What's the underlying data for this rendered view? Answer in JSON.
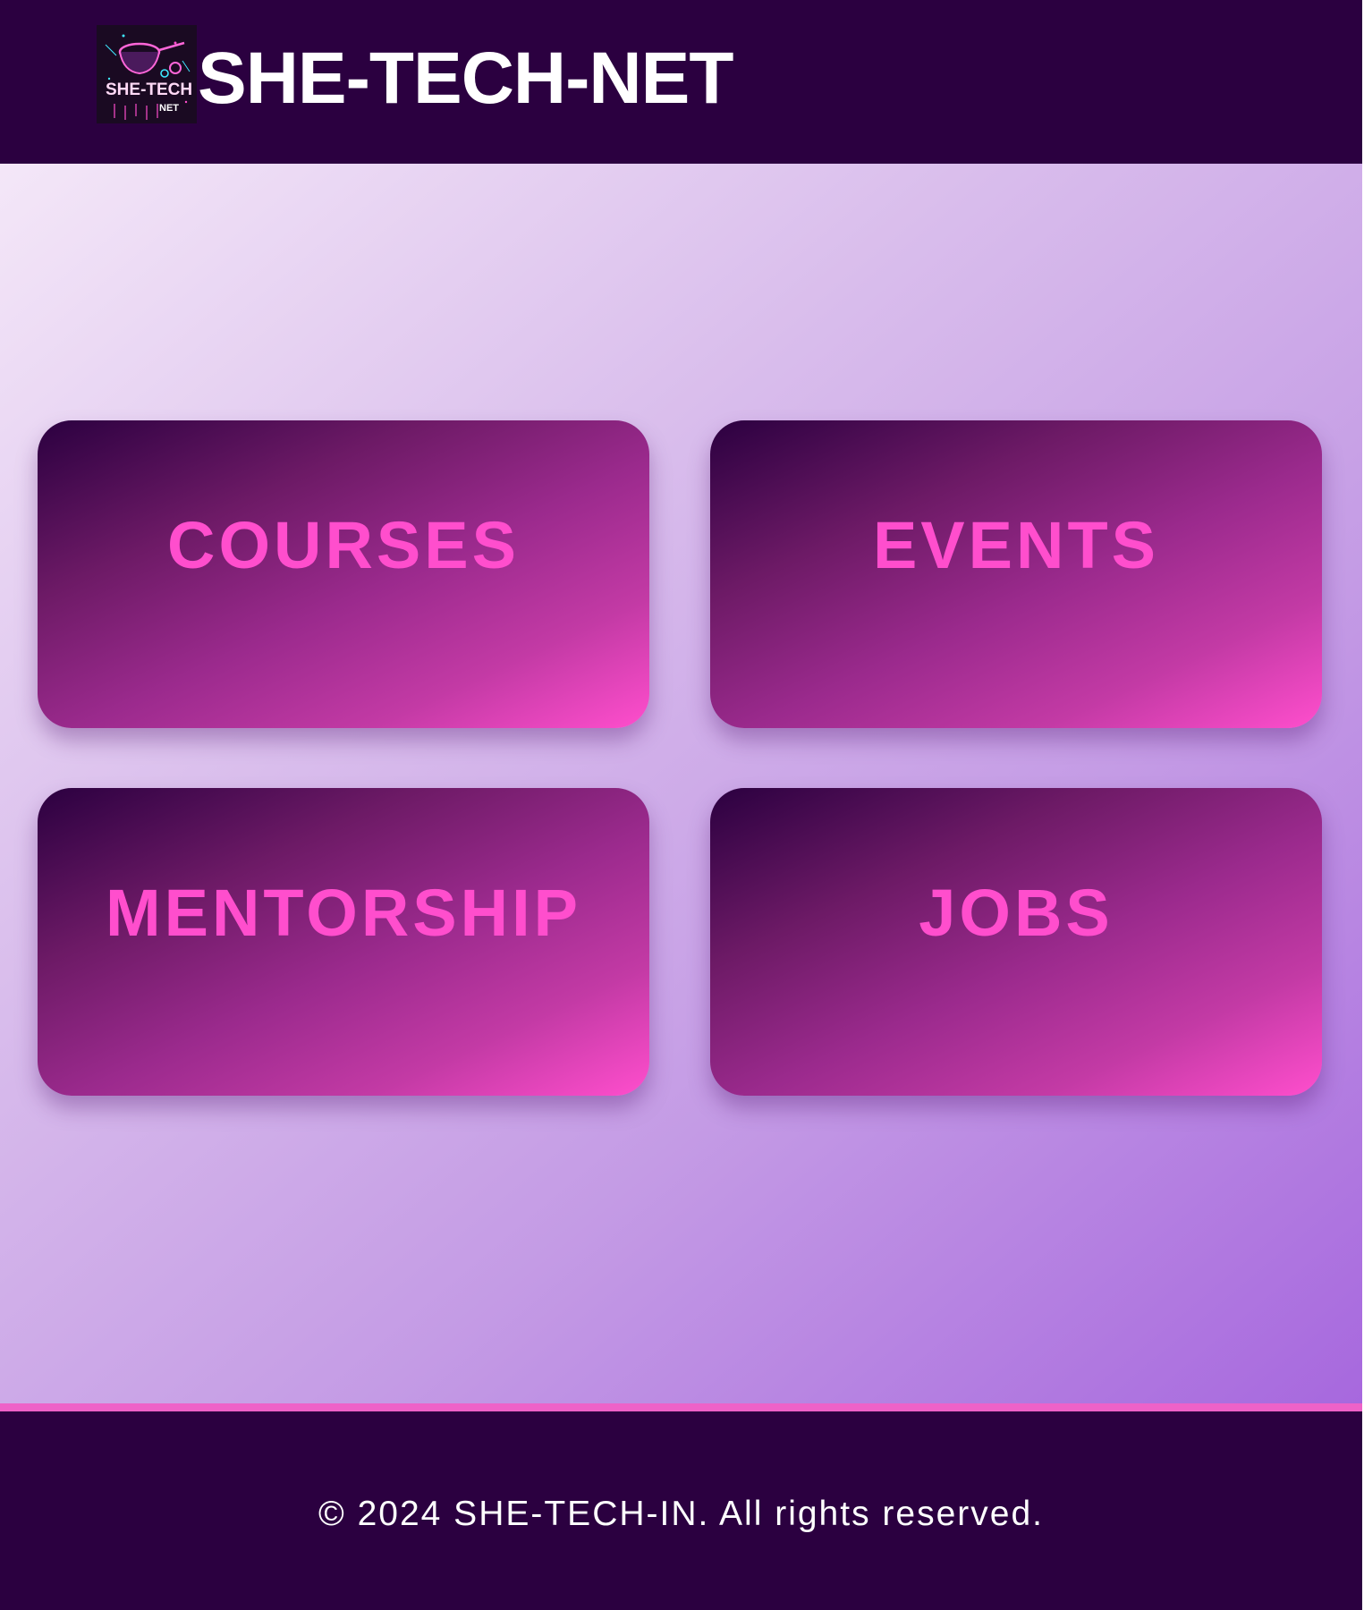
{
  "header": {
    "logo": {
      "icon": "she-tech-net-logo",
      "text_line1": "SHE-TECH",
      "text_line2": "NET"
    },
    "title": "SHE-TECH-NET"
  },
  "cards": [
    {
      "label": "COURSES"
    },
    {
      "label": "EVENTS"
    },
    {
      "label": "MENTORSHIP"
    },
    {
      "label": "JOBS"
    }
  ],
  "footer": {
    "text": "© 2024 SHE-TECH-IN. All rights reserved."
  },
  "colors": {
    "header_bg": "#2b0040",
    "card_label": "#ff4ecd",
    "footer_accent": "#ee62c8"
  }
}
